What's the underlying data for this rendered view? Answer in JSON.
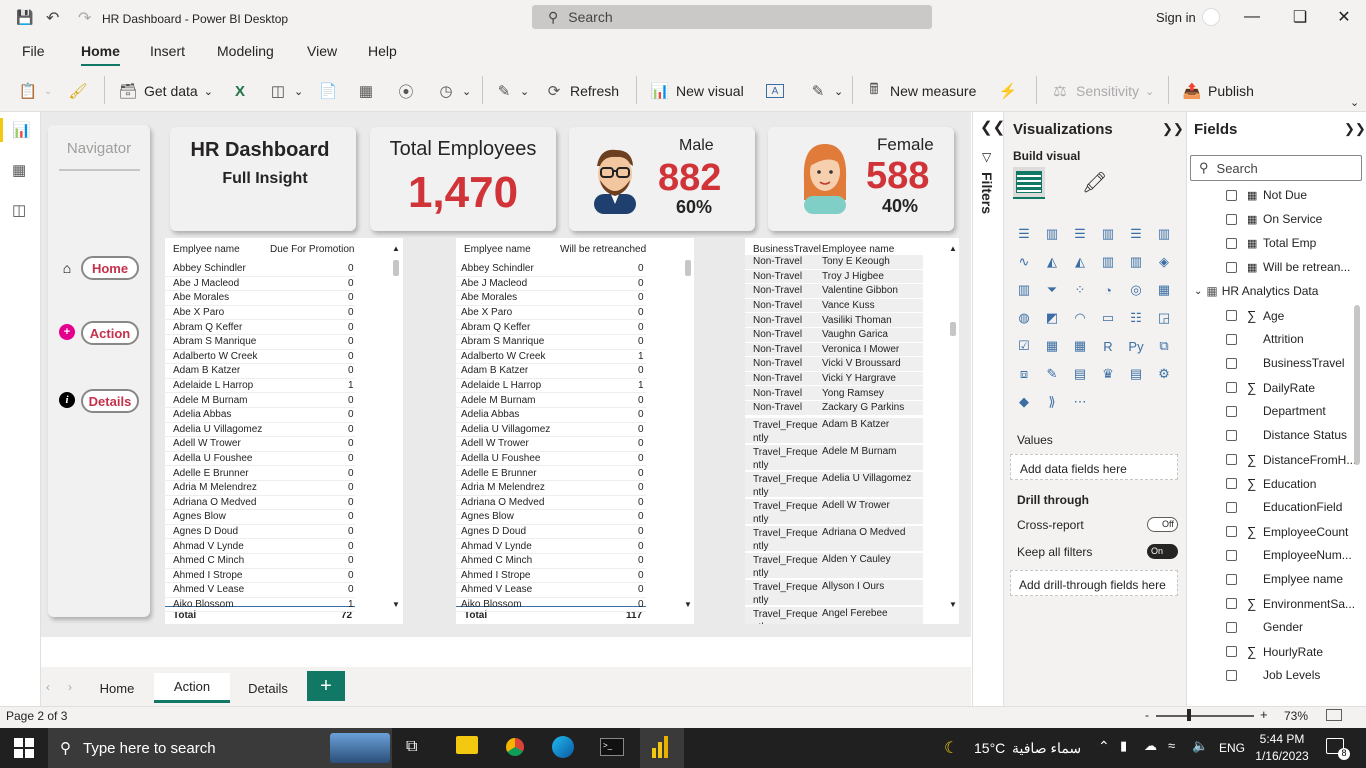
{
  "window": {
    "title": "HR Dashboard - Power BI Desktop",
    "search_placeholder": "Search",
    "signin": "Sign in"
  },
  "menu": [
    "File",
    "Home",
    "Insert",
    "Modeling",
    "View",
    "Help"
  ],
  "ribbon": {
    "get_data": "Get data",
    "refresh": "Refresh",
    "new_visual": "New visual",
    "new_measure": "New measure",
    "sensitivity": "Sensitivity",
    "publish": "Publish"
  },
  "navigator": {
    "title": "Navigator",
    "buttons": [
      "Home",
      "Action",
      "Details"
    ]
  },
  "kpi": {
    "title": "HR Dashboard",
    "subtitle": "Full Insight",
    "total_label": "Total Employees",
    "total_value": "1,470",
    "male_label": "Male",
    "male_value": "882",
    "male_pct": "60%",
    "female_label": "Female",
    "female_value": "588",
    "female_pct": "40%"
  },
  "table1": {
    "headers": [
      "Emplyee name",
      "Due For Promotion"
    ],
    "rows": [
      [
        "Abbey Schindler",
        "0"
      ],
      [
        "Abe J Macleod",
        "0"
      ],
      [
        "Abe Morales",
        "0"
      ],
      [
        "Abe X Paro",
        "0"
      ],
      [
        "Abram Q Keffer",
        "0"
      ],
      [
        "Abram S Manrique",
        "0"
      ],
      [
        "Adalberto W Creek",
        "0"
      ],
      [
        "Adam B Katzer",
        "0"
      ],
      [
        "Adelaide L Harrop",
        "1"
      ],
      [
        "Adele M Burnam",
        "0"
      ],
      [
        "Adelia Abbas",
        "0"
      ],
      [
        "Adelia U Villagomez",
        "0"
      ],
      [
        "Adell W Trower",
        "0"
      ],
      [
        "Adella U Foushee",
        "0"
      ],
      [
        "Adelle E Brunner",
        "0"
      ],
      [
        "Adria M Melendrez",
        "0"
      ],
      [
        "Adriana O Medved",
        "0"
      ],
      [
        "Agnes Blow",
        "0"
      ],
      [
        "Agnes D Doud",
        "0"
      ],
      [
        "Ahmad V Lynde",
        "0"
      ],
      [
        "Ahmed C Minch",
        "0"
      ],
      [
        "Ahmed I Strope",
        "0"
      ],
      [
        "Ahmed V Lease",
        "0"
      ],
      [
        "Aiko Blossom",
        "1"
      ]
    ],
    "total_label": "Total",
    "total": "72"
  },
  "table2": {
    "headers": [
      "Emplyee name",
      "Will be retreanched"
    ],
    "rows": [
      [
        "Abbey Schindler",
        "0"
      ],
      [
        "Abe J Macleod",
        "0"
      ],
      [
        "Abe Morales",
        "0"
      ],
      [
        "Abe X Paro",
        "0"
      ],
      [
        "Abram Q Keffer",
        "0"
      ],
      [
        "Abram S Manrique",
        "0"
      ],
      [
        "Adalberto W Creek",
        "1"
      ],
      [
        "Adam B Katzer",
        "0"
      ],
      [
        "Adelaide L Harrop",
        "1"
      ],
      [
        "Adele M Burnam",
        "0"
      ],
      [
        "Adelia Abbas",
        "0"
      ],
      [
        "Adelia U Villagomez",
        "0"
      ],
      [
        "Adell W Trower",
        "0"
      ],
      [
        "Adella U Foushee",
        "0"
      ],
      [
        "Adelle E Brunner",
        "0"
      ],
      [
        "Adria M Melendrez",
        "0"
      ],
      [
        "Adriana O Medved",
        "0"
      ],
      [
        "Agnes Blow",
        "0"
      ],
      [
        "Agnes D Doud",
        "0"
      ],
      [
        "Ahmad V Lynde",
        "0"
      ],
      [
        "Ahmed C Minch",
        "0"
      ],
      [
        "Ahmed I Strope",
        "0"
      ],
      [
        "Ahmed V Lease",
        "0"
      ],
      [
        "Aiko Blossom",
        "0"
      ]
    ],
    "total_label": "Total",
    "total": "117"
  },
  "table3": {
    "headers": [
      "BusinessTravel",
      "Employee name"
    ],
    "rows": [
      [
        "Non-Travel",
        "Tony E Keough"
      ],
      [
        "Non-Travel",
        "Troy J Higbee"
      ],
      [
        "Non-Travel",
        "Valentine Gibbon"
      ],
      [
        "Non-Travel",
        "Vance Kuss"
      ],
      [
        "Non-Travel",
        "Vasiliki Thoman"
      ],
      [
        "Non-Travel",
        "Vaughn Garica"
      ],
      [
        "Non-Travel",
        "Veronica I Mower"
      ],
      [
        "Non-Travel",
        "Vicki V Broussard"
      ],
      [
        "Non-Travel",
        "Vicki Y Hargrave"
      ],
      [
        "Non-Travel",
        "Yong Ramsey"
      ],
      [
        "Non-Travel",
        "Zackary G Parkins"
      ]
    ],
    "rows2": [
      [
        "Travel_Freque",
        "ntly",
        "Adam B Katzer"
      ],
      [
        "Travel_Freque",
        "ntly",
        "Adele M Burnam"
      ],
      [
        "Travel_Freque",
        "ntly",
        "Adelia U Villagomez"
      ],
      [
        "Travel_Freque",
        "ntly",
        "Adell W Trower"
      ],
      [
        "Travel_Freque",
        "ntly",
        "Adriana O Medved"
      ],
      [
        "Travel_Freque",
        "ntly",
        "Alden Y Cauley"
      ],
      [
        "Travel_Freque",
        "ntly",
        "Allyson I Ours"
      ],
      [
        "Travel_Freque",
        "ntly",
        "Angel Ferebee"
      ]
    ]
  },
  "filters_label": "Filters",
  "visualizations": {
    "title": "Visualizations",
    "build_visual": "Build visual",
    "values": "Values",
    "add_data": "Add data fields here",
    "drill_through": "Drill through",
    "cross_report": "Cross-report",
    "cross_state": "Off",
    "keep_filters": "Keep all filters",
    "keep_state": "On",
    "add_drill": "Add drill-through fields here"
  },
  "fields": {
    "title": "Fields",
    "search": "Search",
    "items": [
      {
        "label": "Not Due",
        "type": "calc"
      },
      {
        "label": "On Service",
        "type": "calc"
      },
      {
        "label": "Total Emp",
        "type": "calc"
      },
      {
        "label": "Will be retrean...",
        "type": "calc"
      }
    ],
    "table_name": "HR Analytics Data",
    "columns": [
      {
        "label": "Age",
        "sigma": true
      },
      {
        "label": "Attrition",
        "sigma": false
      },
      {
        "label": "BusinessTravel",
        "sigma": false
      },
      {
        "label": "DailyRate",
        "sigma": true
      },
      {
        "label": "Department",
        "sigma": false
      },
      {
        "label": "Distance Status",
        "sigma": false
      },
      {
        "label": "DistanceFromH...",
        "sigma": true
      },
      {
        "label": "Education",
        "sigma": true
      },
      {
        "label": "EducationField",
        "sigma": false
      },
      {
        "label": "EmployeeCount",
        "sigma": true
      },
      {
        "label": "EmployeeNum...",
        "sigma": false
      },
      {
        "label": "Emplyee name",
        "sigma": false
      },
      {
        "label": "EnvironmentSa...",
        "sigma": true
      },
      {
        "label": "Gender",
        "sigma": false
      },
      {
        "label": "HourlyRate",
        "sigma": true
      },
      {
        "label": "Job Levels",
        "sigma": false
      }
    ]
  },
  "pages": [
    "Home",
    "Action",
    "Details"
  ],
  "status": {
    "page": "Page 2 of 3",
    "zoom": "73%"
  },
  "taskbar": {
    "search": "Type here to search",
    "weather": "15°C",
    "weather_text": "سماء صافية",
    "lang": "ENG",
    "time": "5:44 PM",
    "date": "1/16/2023",
    "notif": "8"
  }
}
